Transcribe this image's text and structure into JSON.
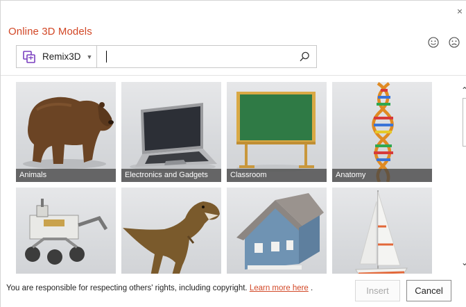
{
  "dialog": {
    "title": "Online 3D Models",
    "close_glyph": "×",
    "title_color": "#d24726"
  },
  "feedback": {
    "smile_icon": "smile-icon",
    "frown_icon": "frown-icon"
  },
  "search": {
    "provider_label": "Remix3D",
    "provider_icon": "remix3d-icon",
    "query": "",
    "search_icon": "search-icon"
  },
  "tiles": [
    {
      "caption": "Animals"
    },
    {
      "caption": "Electronics and Gadgets"
    },
    {
      "caption": "Classroom"
    },
    {
      "caption": "Anatomy"
    },
    {
      "caption": ""
    },
    {
      "caption": ""
    },
    {
      "caption": ""
    },
    {
      "caption": ""
    }
  ],
  "footer": {
    "notice": "You are responsible for respecting others' rights, including copyright.",
    "link": "Learn more here",
    "after_link": ".",
    "insert_label": "Insert",
    "cancel_label": "Cancel"
  },
  "scroll": {
    "up_glyph": "^",
    "down_glyph": "v"
  }
}
